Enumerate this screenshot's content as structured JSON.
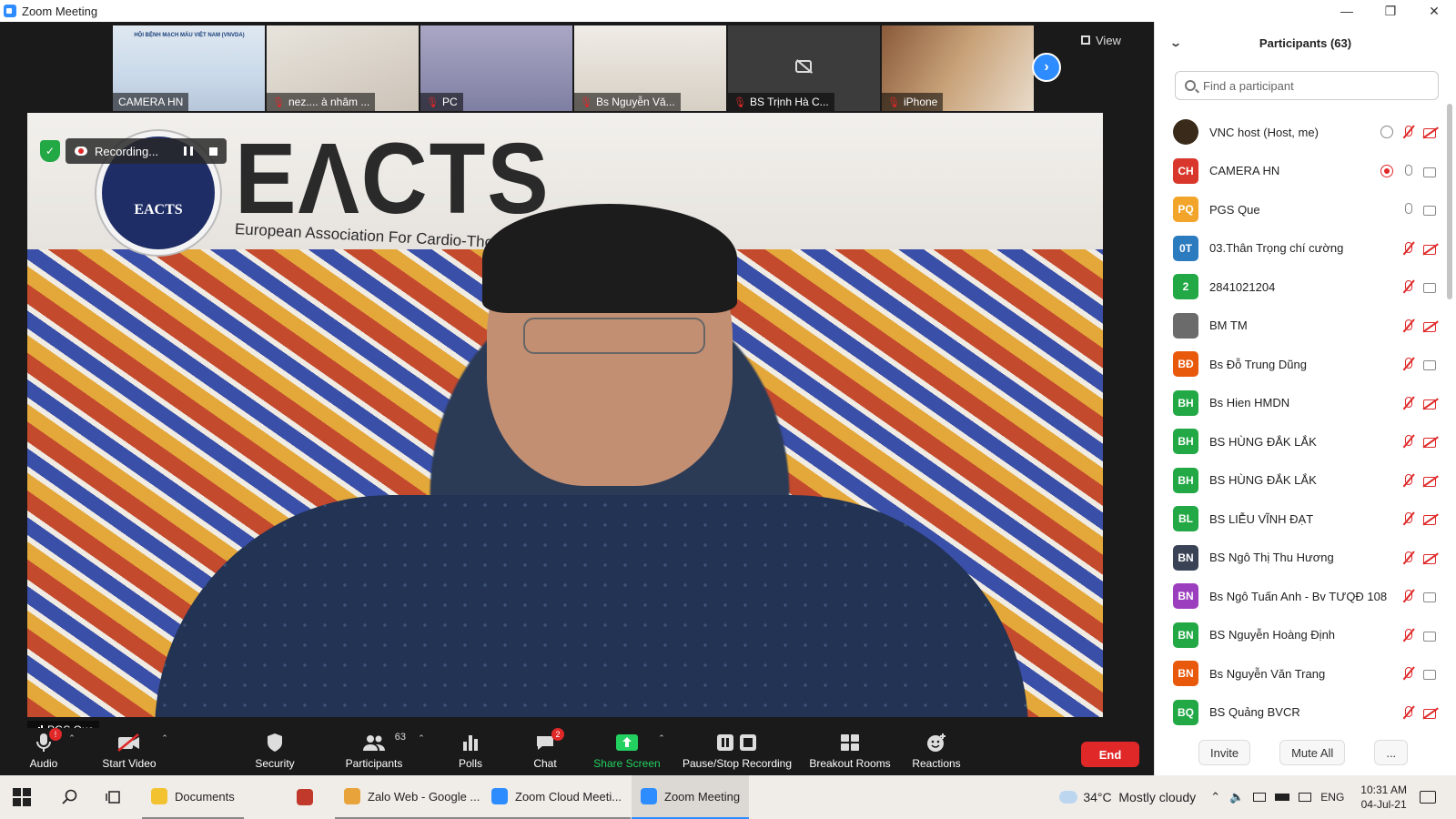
{
  "window": {
    "title": "Zoom Meeting",
    "minimize": "—",
    "restore": "❐",
    "close": "✕"
  },
  "filmstrip": {
    "banner_text": "HỘI BỆNH MẠCH MÁU VIỆT NAM (VNVDA)",
    "tiles": [
      {
        "label": "CAMERA HN",
        "muted": false
      },
      {
        "label": "nez.... à nhâm ...",
        "muted": true
      },
      {
        "label": "PC",
        "muted": true
      },
      {
        "label": "Bs Nguyễn Vă...",
        "muted": true
      },
      {
        "label": "BS Trịnh Hà C...",
        "muted": true
      },
      {
        "label": "iPhone",
        "muted": true
      }
    ],
    "view_label": "View",
    "next_arrow": "›"
  },
  "video": {
    "logo_text": "EACTS",
    "banner_title": "EΛCTS",
    "banner_sub": "European Association For Cardio-Thoracic Surge",
    "recording_label": "Recording...",
    "speaker": "PGS Que"
  },
  "toolbar": {
    "audio": "Audio",
    "audio_badge": "!",
    "start_video": "Start Video",
    "security": "Security",
    "participants": "Participants",
    "participants_count": "63",
    "polls": "Polls",
    "chat": "Chat",
    "chat_badge": "2",
    "share_screen": "Share Screen",
    "recording": "Pause/Stop Recording",
    "breakout": "Breakout Rooms",
    "reactions": "Reactions",
    "end": "End"
  },
  "panel": {
    "title": "Participants (63)",
    "search_placeholder": "Find a participant",
    "participants": [
      {
        "initials": "",
        "name": "VNC host (Host, me)",
        "color": "#3a2a1a",
        "mic": "off",
        "cam": "off",
        "extra": "cloud"
      },
      {
        "initials": "CH",
        "name": "CAMERA HN",
        "color": "#d9372b",
        "mic": "on",
        "cam": "on",
        "extra": "rec"
      },
      {
        "initials": "PQ",
        "name": "PGS Que",
        "color": "#f2a52a",
        "mic": "on",
        "cam": "on",
        "extra": ""
      },
      {
        "initials": "0T",
        "name": "03.Thân Trọng chí cường",
        "color": "#2d7bbf",
        "mic": "off",
        "cam": "off",
        "extra": ""
      },
      {
        "initials": "2",
        "name": "2841021204",
        "color": "#23a846",
        "mic": "off",
        "cam": "on",
        "extra": ""
      },
      {
        "initials": "",
        "name": "BM TM",
        "color": "#6b6b6b",
        "mic": "off",
        "cam": "off",
        "extra": ""
      },
      {
        "initials": "BĐ",
        "name": "Bs Đỗ Trung Dũng",
        "color": "#e8590c",
        "mic": "off",
        "cam": "on",
        "extra": ""
      },
      {
        "initials": "BH",
        "name": "Bs Hien HMDN",
        "color": "#23a846",
        "mic": "off",
        "cam": "off",
        "extra": ""
      },
      {
        "initials": "BH",
        "name": "BS HÙNG ĐẮK LẮK",
        "color": "#23a846",
        "mic": "off",
        "cam": "off",
        "extra": ""
      },
      {
        "initials": "BH",
        "name": "BS HÙNG ĐẮK LẮK",
        "color": "#23a846",
        "mic": "off",
        "cam": "off",
        "extra": ""
      },
      {
        "initials": "BL",
        "name": "BS LIỄU VĨNH ĐẠT",
        "color": "#23a846",
        "mic": "off",
        "cam": "off",
        "extra": ""
      },
      {
        "initials": "BN",
        "name": "BS Ngô Thị Thu Hương",
        "color": "#3a4356",
        "mic": "off",
        "cam": "off",
        "extra": ""
      },
      {
        "initials": "BN",
        "name": "Bs Ngô Tuấn Anh - Bv TƯQĐ 108",
        "color": "#9b3fbf",
        "mic": "off",
        "cam": "on",
        "extra": ""
      },
      {
        "initials": "BN",
        "name": "BS Nguyễn Hoàng Định",
        "color": "#23a846",
        "mic": "off",
        "cam": "on",
        "extra": ""
      },
      {
        "initials": "BN",
        "name": "Bs Nguyễn Văn Trang",
        "color": "#e8590c",
        "mic": "off",
        "cam": "on",
        "extra": ""
      },
      {
        "initials": "BQ",
        "name": "BS Quảng BVCR",
        "color": "#23a846",
        "mic": "off",
        "cam": "off",
        "extra": ""
      }
    ],
    "invite": "Invite",
    "mute_all": "Mute All",
    "more": "..."
  },
  "taskbar": {
    "items": [
      {
        "label": "Documents",
        "state": "open",
        "color": "#f2c230"
      },
      {
        "label": "",
        "state": "none",
        "color": "#c0392b"
      },
      {
        "label": "Zalo Web - Google ...",
        "state": "open",
        "color": "#e8a33a"
      },
      {
        "label": "Zoom Cloud Meeti...",
        "state": "open",
        "color": "#2d8cff"
      },
      {
        "label": "Zoom Meeting",
        "state": "active",
        "color": "#2d8cff"
      }
    ],
    "weather": "34°C  Mostly cloudy",
    "lang": "ENG",
    "time": "10:31 AM",
    "date": "04-Jul-21"
  }
}
